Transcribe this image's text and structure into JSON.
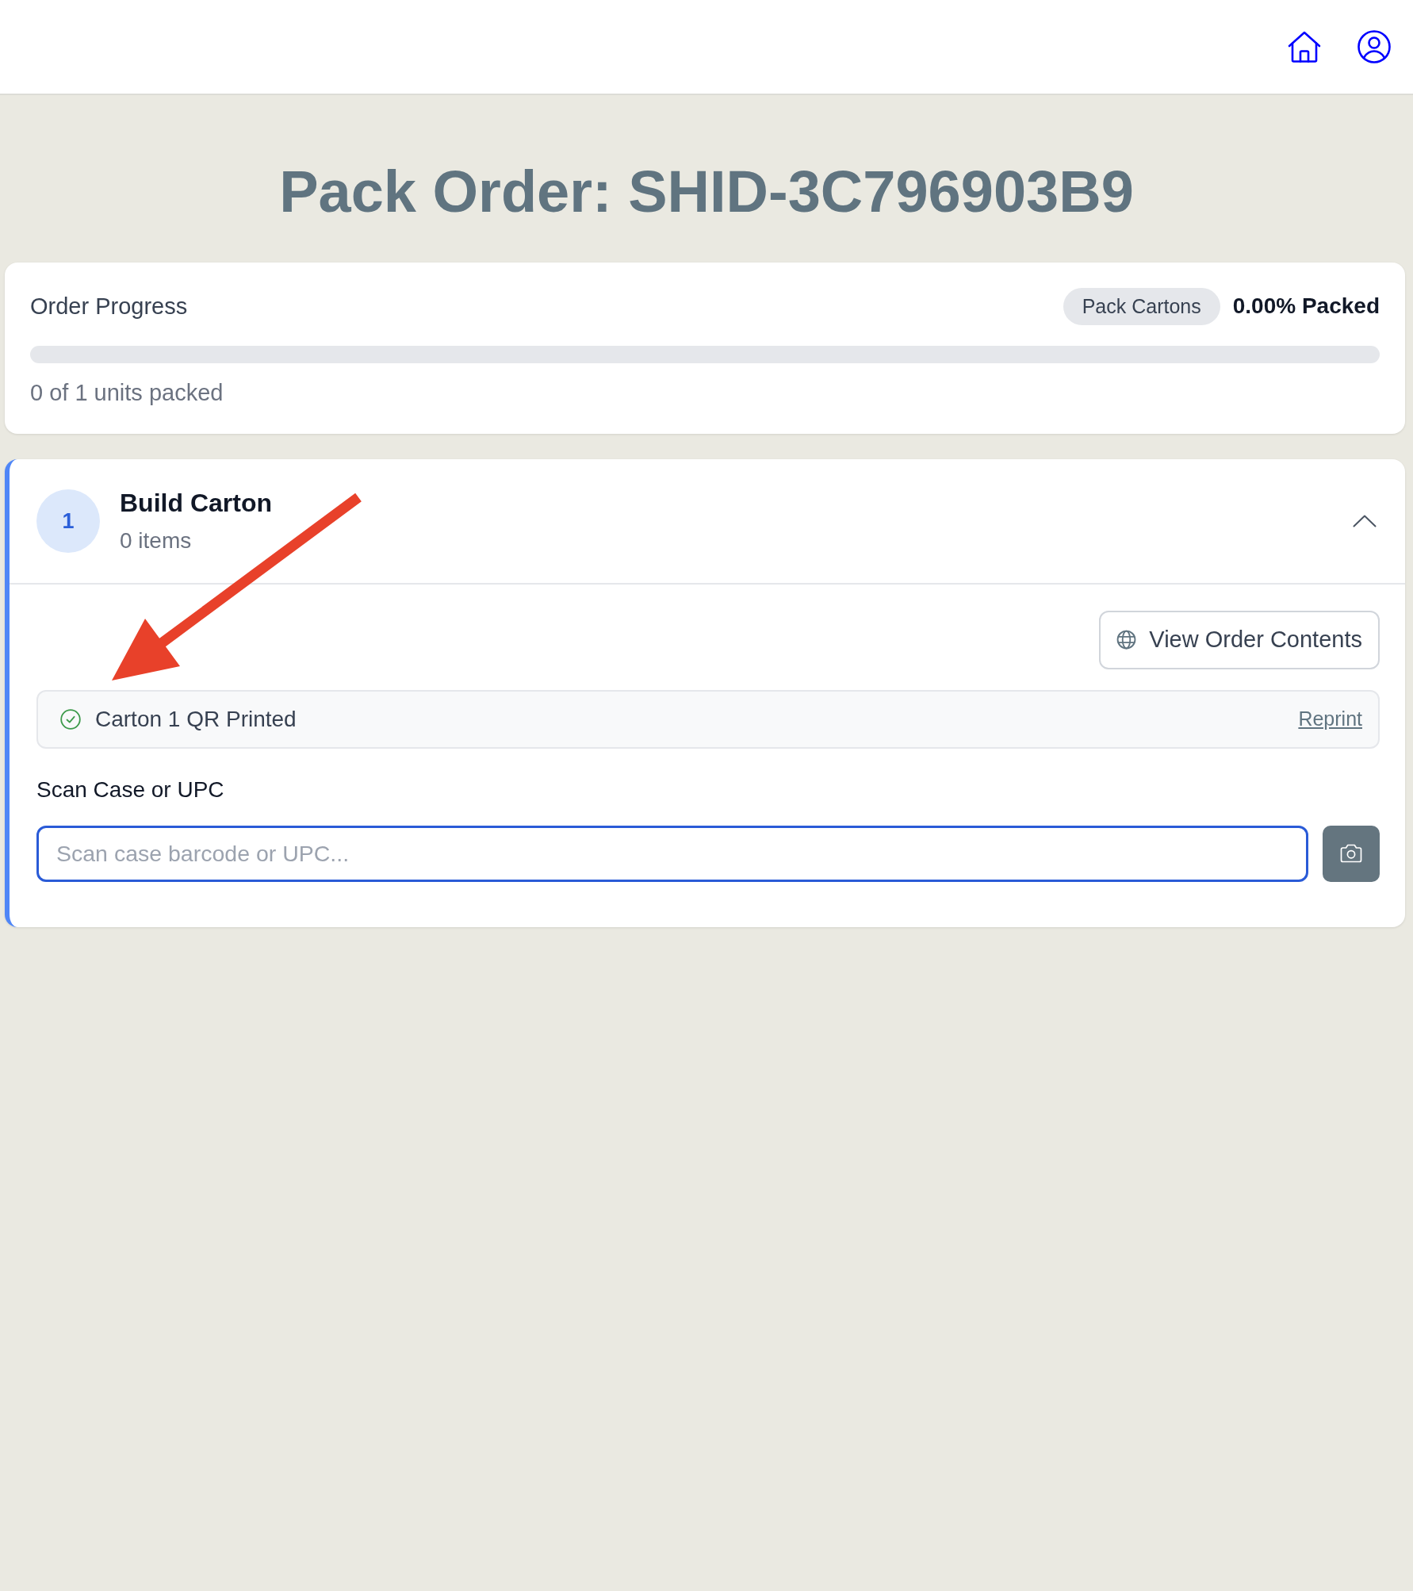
{
  "title": "Pack Order: SHID-3C796903B9",
  "order_progress": {
    "label": "Order Progress",
    "stage": "Pack Cartons",
    "percent": "0.00% Packed",
    "level": 0,
    "units": "0 of 1 units packed"
  },
  "cartons": [
    {
      "number": "1",
      "title": "Build Carton",
      "subtitle": "0 items",
      "active": true,
      "expanded": true,
      "view_button": "View Order Contents",
      "qr_status": {
        "text": "Carton 1 QR Printed",
        "action": "Reprint"
      },
      "scan": {
        "label": "Scan Case or UPC",
        "placeholder": "Scan case barcode or UPC...",
        "focused": true
      }
    }
  ],
  "annotations": [
    {
      "kind": "arrow"
    }
  ]
}
